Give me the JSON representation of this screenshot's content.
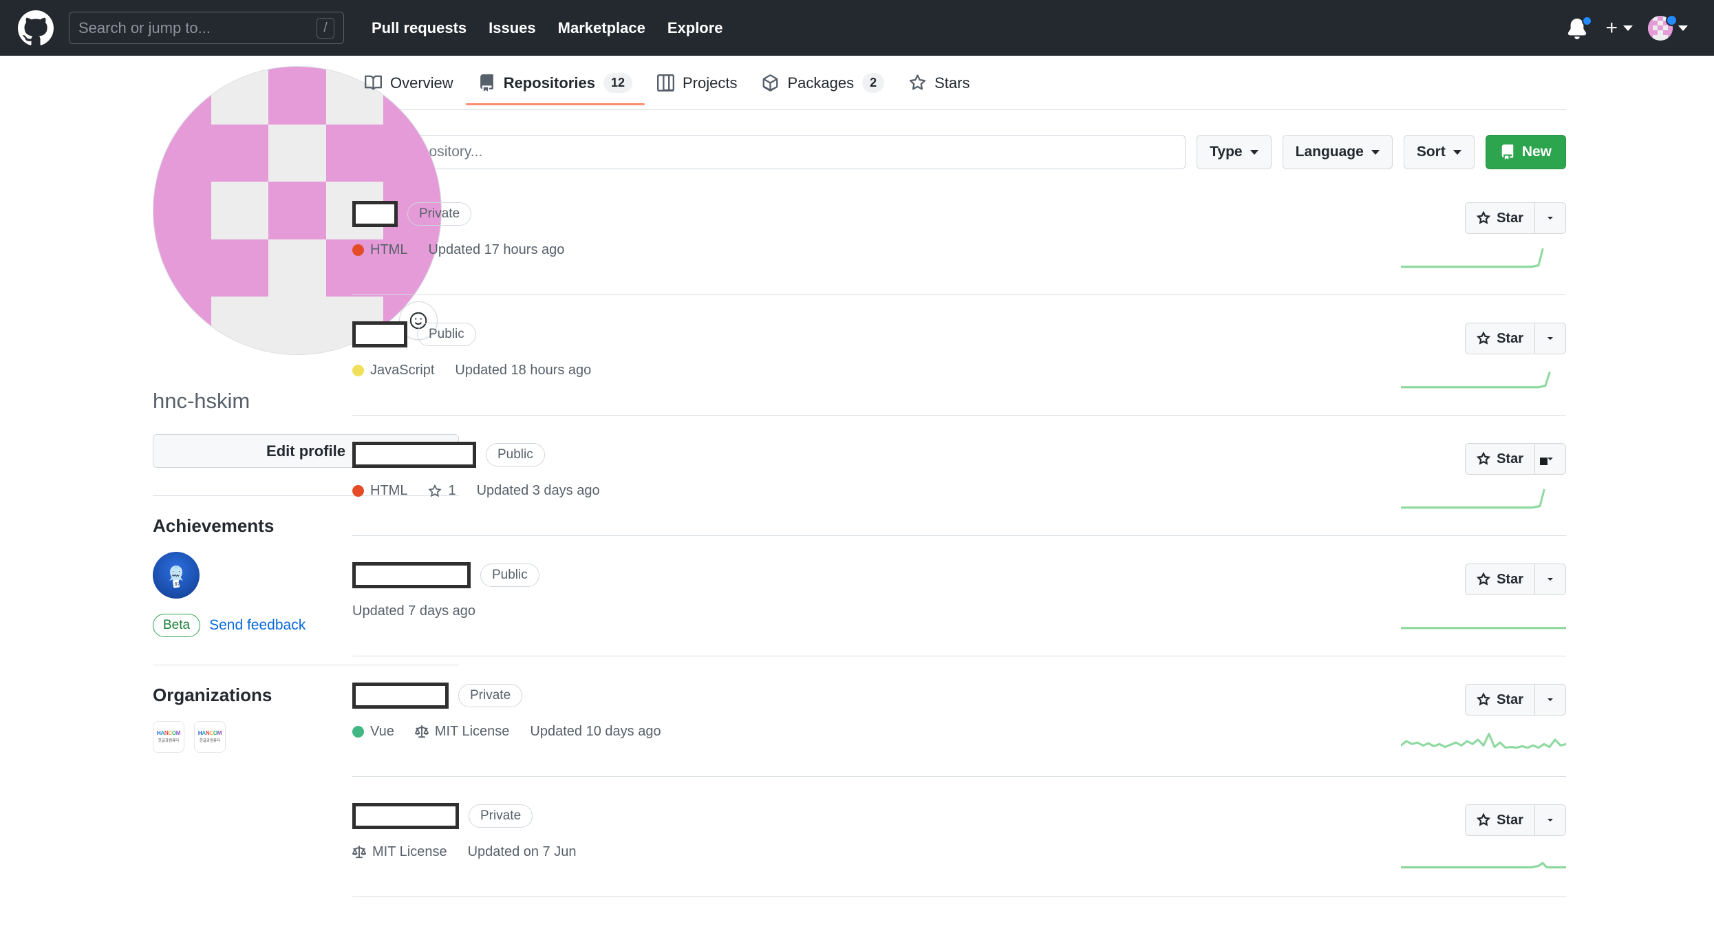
{
  "header": {
    "logo_icon": "github-mark-icon",
    "search": {
      "placeholder": "Search or jump to...",
      "shortcut_key": "/"
    },
    "nav": [
      {
        "label": "Pull requests"
      },
      {
        "label": "Issues"
      },
      {
        "label": "Marketplace"
      },
      {
        "label": "Explore"
      }
    ],
    "notifications_icon": "bell-icon",
    "has_unread_notifications": true,
    "create_new_icon": "plus-icon",
    "account_icon": "avatar-icon",
    "background_color": "#24292f"
  },
  "profile": {
    "avatar_icon": "identicon-avatar",
    "avatar_colors": {
      "foreground": "#e49bd8",
      "background": "#ededed"
    },
    "status_button_icon": "smiley-icon",
    "username": "hnc-hskim",
    "edit_profile_label": "Edit profile",
    "achievements": {
      "heading": "Achievements",
      "badges": [
        {
          "name": "pull-shark-achievement",
          "icon": "shark-icon"
        }
      ],
      "beta_label": "Beta",
      "feedback_label": "Send feedback"
    },
    "organizations": {
      "heading": "Organizations",
      "items": [
        {
          "name": "hancom-org-1",
          "logo_text": "HANCOM",
          "logo_sub": "한글과컴퓨터"
        },
        {
          "name": "hancom-org-2",
          "logo_text": "HANCOM",
          "logo_sub": "한글과컴퓨터"
        }
      ]
    }
  },
  "tabs": [
    {
      "label": "Overview",
      "icon": "book-icon",
      "count": null,
      "active": false
    },
    {
      "label": "Repositories",
      "icon": "repo-icon",
      "count": "12",
      "active": true
    },
    {
      "label": "Projects",
      "icon": "project-icon",
      "count": null,
      "active": false
    },
    {
      "label": "Packages",
      "icon": "package-icon",
      "count": "2",
      "active": false
    },
    {
      "label": "Stars",
      "icon": "star-icon",
      "count": null,
      "active": false
    }
  ],
  "toolbar": {
    "search_placeholder": "Find a repository...",
    "search_value": "",
    "type_label": "Type",
    "language_label": "Language",
    "sort_label": "Sort",
    "new_label": "New",
    "new_icon": "repo-icon",
    "new_button_color": "#2da44e"
  },
  "repo_actions": {
    "star_label": "Star",
    "star_icon": "star-icon",
    "caret_icon": "chevron-down-icon"
  },
  "repositories": [
    {
      "name_redacted": true,
      "redaction_width": 66,
      "visibility": "Private",
      "language": "HTML",
      "language_color": "#e34c26",
      "license": null,
      "stars": null,
      "updated": "Updated 17 hours ago",
      "cursor_on_caret": false,
      "sparkline": "0,28 150,28 190,28 200,26 206,4"
    },
    {
      "name_redacted": true,
      "redaction_width": 80,
      "visibility": "Public",
      "language": "JavaScript",
      "language_color": "#f1e05a",
      "license": null,
      "stars": null,
      "updated": "Updated 18 hours ago",
      "cursor_on_caret": false,
      "sparkline": "0,28 170,28 200,28 210,26 216,8"
    },
    {
      "name_redacted": true,
      "redaction_width": 180,
      "visibility": "Public",
      "language": "HTML",
      "language_color": "#e34c26",
      "license": null,
      "stars": "1",
      "updated": "Updated 3 days ago",
      "cursor_on_caret": true,
      "sparkline": "0,28 150,28 190,28 202,26 208,4"
    },
    {
      "name_redacted": true,
      "redaction_width": 172,
      "visibility": "Public",
      "language": null,
      "language_color": null,
      "license": null,
      "stars": null,
      "updated": "Updated 7 days ago",
      "cursor_on_caret": false,
      "sparkline": "0,28 240,28"
    },
    {
      "name_redacted": true,
      "redaction_width": 140,
      "visibility": "Private",
      "language": "Vue",
      "language_color": "#41b883",
      "license": "MIT License",
      "license_icon": "law-icon",
      "stars": null,
      "updated": "Updated 10 days ago",
      "cursor_on_caret": false,
      "sparkline": "0,24 8,18 16,22 24,20 32,24 40,21 48,25 56,22 64,26 72,23 80,20 88,24 96,18 104,22 112,16 120,24 128,8 136,26 144,20 152,27 160,26 168,27 176,25 184,27 192,24 200,27 208,22 216,26 224,16 232,24 240,22"
    },
    {
      "name_redacted": true,
      "redaction_width": 155,
      "visibility": "Private",
      "language": null,
      "language_color": null,
      "license": "MIT License",
      "license_icon": "law-icon",
      "stars": null,
      "updated": "Updated on 7 Jun",
      "cursor_on_caret": false,
      "sparkline": "0,26 190,26 200,24 206,20 212,26 240,26"
    }
  ]
}
